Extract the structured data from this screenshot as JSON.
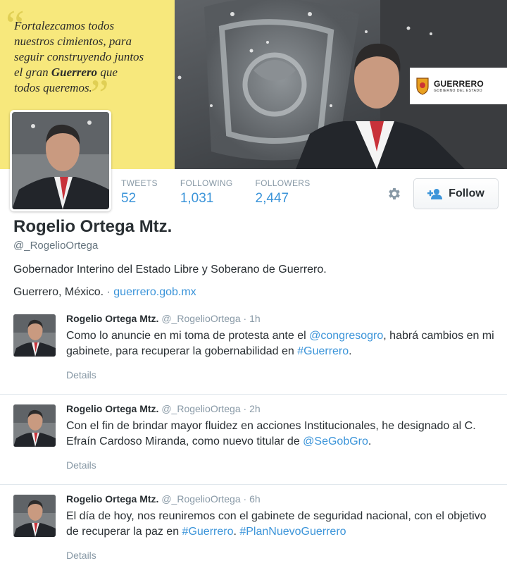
{
  "header": {
    "quote_line1": "Fortalezcamos todos",
    "quote_line2": "nuestros cimientos, para",
    "quote_line3": "seguir construyendo juntos",
    "quote_line4_pre": "el gran ",
    "quote_line4_bold": "Guerrero",
    "quote_line4_post": " que",
    "quote_line5": "todos queremos.",
    "logo_name": "GUERRERO",
    "logo_sub": "GOBIERNO DEL ESTADO",
    "accent_color": "#f7e87c"
  },
  "stats": [
    {
      "label": "TWEETS",
      "value": "52"
    },
    {
      "label": "FOLLOWING",
      "value": "1,031"
    },
    {
      "label": "FOLLOWERS",
      "value": "2,447"
    }
  ],
  "actions": {
    "settings_icon": "gear-icon",
    "follow_label": "Follow",
    "follow_icon": "add-person-icon"
  },
  "profile": {
    "name": "Rogelio Ortega Mtz.",
    "handle": "@_RogelioOrtega",
    "bio": "Gobernador Interino del Estado Libre y Soberano de Guerrero.",
    "location": "Guerrero, México.",
    "separator": "·",
    "website": "guerrero.gob.mx"
  },
  "tweets": [
    {
      "name": "Rogelio Ortega Mtz.",
      "handle": "@_RogelioOrtega",
      "dot": "·",
      "time": "1h",
      "text_parts": [
        {
          "t": "Como lo anuncie en mi toma de protesta ante el ",
          "link": false
        },
        {
          "t": "@congresogro",
          "link": true
        },
        {
          "t": ", habrá cambios en mi gabinete, para recuperar la gobernabilidad en ",
          "link": false
        },
        {
          "t": "#Guerrero",
          "link": true
        },
        {
          "t": ".",
          "link": false
        }
      ],
      "details": "Details"
    },
    {
      "name": "Rogelio Ortega Mtz.",
      "handle": "@_RogelioOrtega",
      "dot": "·",
      "time": "2h",
      "text_parts": [
        {
          "t": "Con el fin de brindar mayor fluidez en acciones Institucionales, he designado al C. Efraín Cardoso Miranda, como nuevo titular de ",
          "link": false
        },
        {
          "t": "@SeGobGro",
          "link": true
        },
        {
          "t": ".",
          "link": false
        }
      ],
      "details": "Details"
    },
    {
      "name": "Rogelio Ortega Mtz.",
      "handle": "@_RogelioOrtega",
      "dot": "·",
      "time": "6h",
      "text_parts": [
        {
          "t": "El día de hoy, nos reuniremos con el gabinete de seguridad nacional, con el objetivo de recuperar la paz en ",
          "link": false
        },
        {
          "t": "#Guerrero",
          "link": true
        },
        {
          "t": ". ",
          "link": false
        },
        {
          "t": "#PlanNuevoGuerrero",
          "link": true
        }
      ],
      "details": "Details"
    }
  ]
}
